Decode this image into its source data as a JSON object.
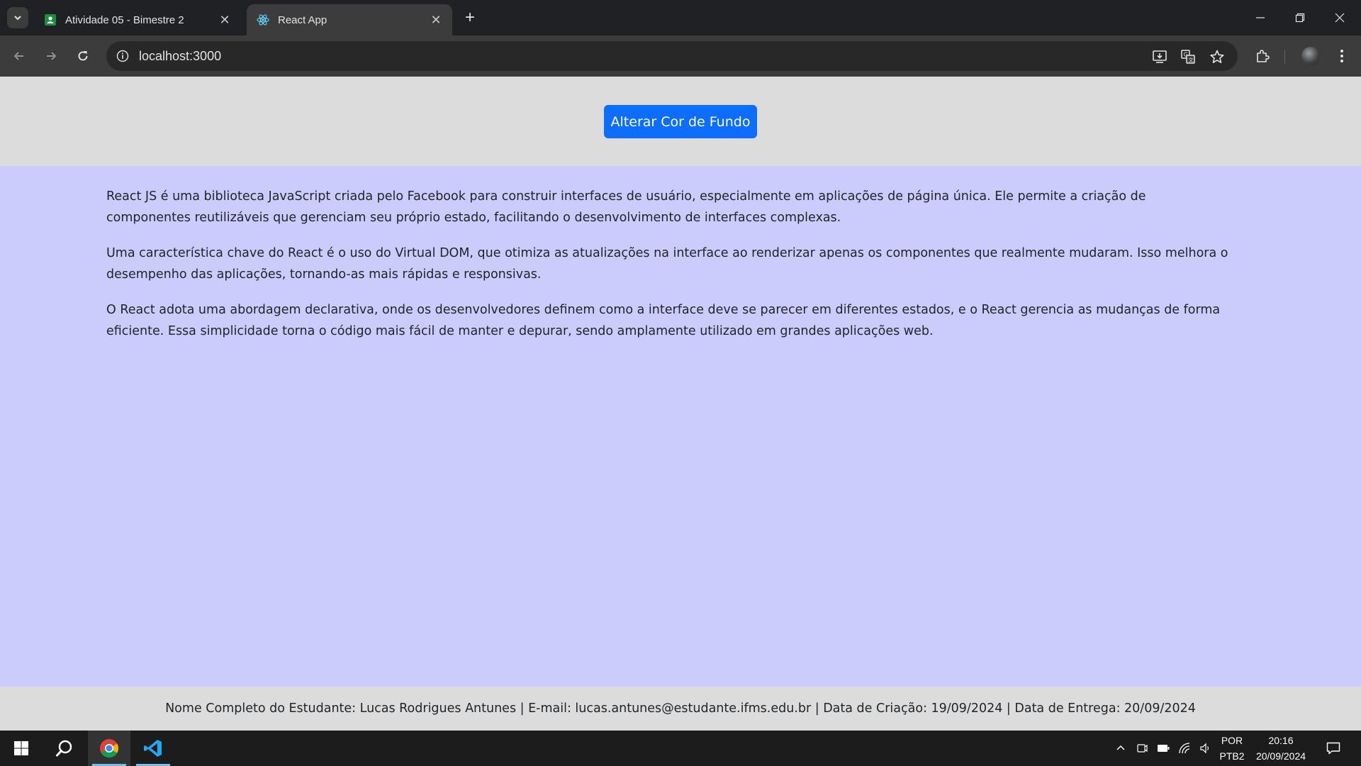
{
  "browser": {
    "tabs": [
      {
        "title": "Atividade 05 - Bimestre 2",
        "icon": "classroom-icon"
      },
      {
        "title": "React App",
        "icon": "react-icon"
      }
    ],
    "address": "localhost:3000"
  },
  "page": {
    "button_label": "Alterar Cor de Fundo",
    "paragraphs": [
      "React JS é uma biblioteca JavaScript criada pelo Facebook para construir interfaces de usuário, especialmente em aplicações de página única. Ele permite a criação de componentes reutilizáveis que gerenciam seu próprio estado, facilitando o desenvolvimento de interfaces complexas.",
      "Uma característica chave do React é o uso do Virtual DOM, que otimiza as atualizações na interface ao renderizar apenas os componentes que realmente mudaram. Isso melhora o desempenho das aplicações, tornando-as mais rápidas e responsivas.",
      "O React adota uma abordagem declarativa, onde os desenvolvedores definem como a interface deve se parecer em diferentes estados, e o React gerencia as mudanças de forma eficiente. Essa simplicidade torna o código mais fácil de manter e depurar, sendo amplamente utilizado em grandes aplicações web."
    ],
    "footer": "Nome Completo do Estudante: Lucas Rodrigues Antunes | E-mail: lucas.antunes@estudante.ifms.edu.br | Data de Criação: 19/09/2024 | Data de Entrega: 20/09/2024",
    "colors": {
      "header_bg": "#dcdcdc",
      "body_bg": "#cbcbfc",
      "button_bg": "#0d6efd"
    }
  },
  "taskbar": {
    "apps": [
      "start-icon",
      "search-icon",
      "chrome-icon",
      "vscode-icon"
    ],
    "language_top": "POR",
    "language_bottom": "PTB2",
    "time": "20:16",
    "date": "20/09/2024"
  }
}
